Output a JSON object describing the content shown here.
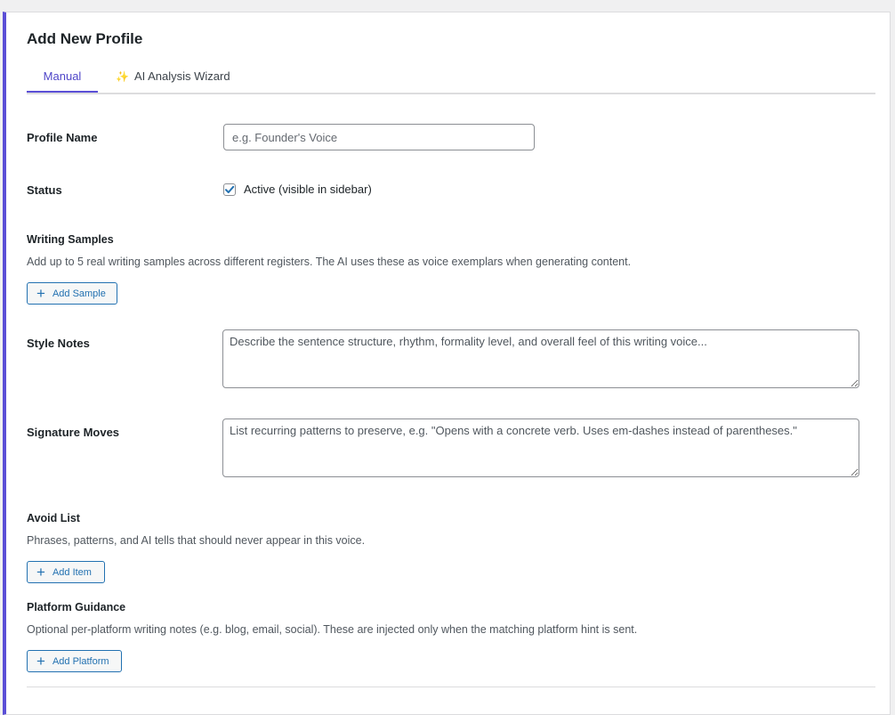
{
  "header": {
    "title": "Add New Profile"
  },
  "tabs": [
    {
      "label": "Manual",
      "active": true
    },
    {
      "label": "AI Analysis Wizard",
      "icon": "sparkles-icon",
      "active": false
    }
  ],
  "profile_name": {
    "label": "Profile Name",
    "placeholder": "e.g. Founder's Voice",
    "value": ""
  },
  "status": {
    "label": "Status",
    "checkbox_label": "Active (visible in sidebar)",
    "checked": true
  },
  "writing_samples": {
    "label": "Writing Samples",
    "description": "Add up to 5 real writing samples across different registers. The AI uses these as voice exemplars when generating content.",
    "button_label": "Add Sample"
  },
  "style_notes": {
    "label": "Style Notes",
    "placeholder": "Describe the sentence structure, rhythm, formality level, and overall feel of this writing voice..."
  },
  "signature_moves": {
    "label": "Signature Moves",
    "placeholder": "List recurring patterns to preserve, e.g. \"Opens with a concrete verb. Uses em-dashes instead of parentheses.\""
  },
  "avoid_list": {
    "label": "Avoid List",
    "description": "Phrases, patterns, and AI tells that should never appear in this voice.",
    "button_label": "Add Item"
  },
  "platform_guidance": {
    "label": "Platform Guidance",
    "description": "Optional per-platform writing notes (e.g. blog, email, social). These are injected only when the matching platform hint is sent.",
    "button_label": "Add Platform"
  },
  "colors": {
    "accent": "#5b4fd6",
    "button": "#2271b1",
    "checkbox": "#2271b1"
  }
}
